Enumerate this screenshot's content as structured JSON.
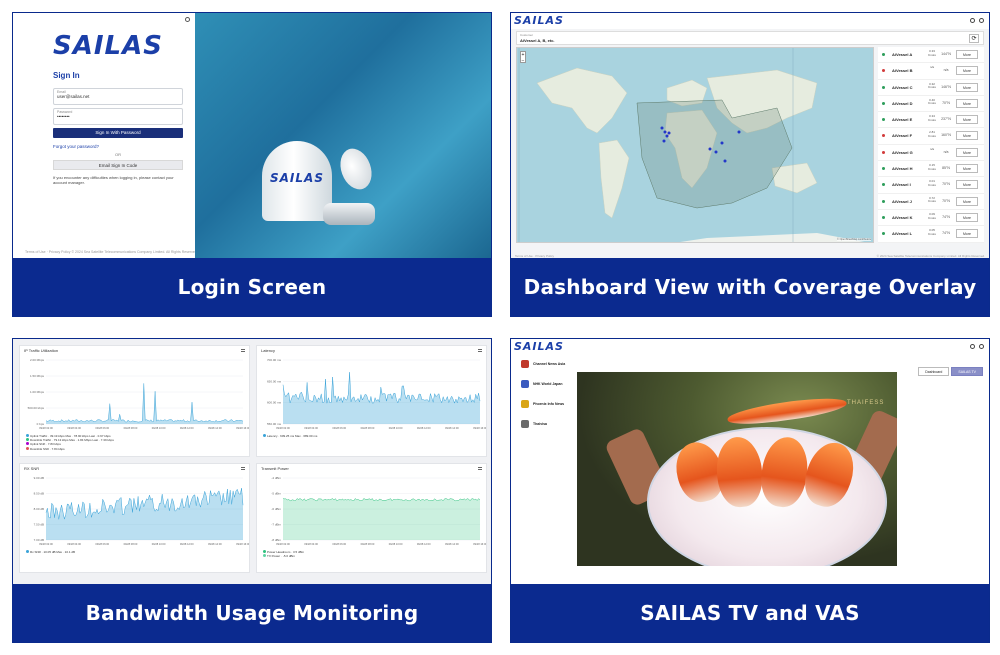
{
  "captions": {
    "login": "Login Screen",
    "dashboard": "Dashboard View with Coverage Overlay",
    "bandwidth": "Bandwidth Usage Monitoring",
    "tv": "SAILAS TV and VAS"
  },
  "brand": {
    "name": "SAILAS",
    "primary": "#0b2a8f",
    "accent": "#1b3fa8"
  },
  "login": {
    "title": "Sign In",
    "email_label": "Email",
    "email_value": "user@sailas.net",
    "password_label": "Password",
    "password_value": "••••••••",
    "sign_in_button": "Sign In With Password",
    "forgot": "Forgot your password?",
    "or": "OR",
    "email_code_button": "Email Sign In Code",
    "help_text": "If you encounter any difficulties when logging in, please contact your account manager.",
    "footer": "Terms of Use · Privacy Policy   © 2024 Sea Satellite Telecommunications Company Limited. All Rights Reserved."
  },
  "dashboard": {
    "filter_label": "Customer",
    "filter_value": "AiVessel A, B, etc.",
    "refresh_icon": "refresh-icon",
    "map_attribution": "© OpenStreetMap contributors",
    "vessels": [
      {
        "name": "AiVessel A",
        "speed": "0.33 Knots",
        "heading": "144°N",
        "status": "#2e9e5b"
      },
      {
        "name": "AiVessel B",
        "speed": "n/a",
        "heading": "n/a",
        "status": "#d23b3b"
      },
      {
        "name": "AiVessel C",
        "speed": "0.32 Knots",
        "heading": "146°N",
        "status": "#2e9e5b"
      },
      {
        "name": "AiVessel D",
        "speed": "0.40 Knots",
        "heading": "70°N",
        "status": "#2e9e5b"
      },
      {
        "name": "AiVessel E",
        "speed": "0.34 Knots",
        "heading": "237°N",
        "status": "#2e9e5b"
      },
      {
        "name": "AiVessel F",
        "speed": "2.81 Knots",
        "heading": "160°N",
        "status": "#d23b3b"
      },
      {
        "name": "AiVessel G",
        "speed": "n/a",
        "heading": "n/a",
        "status": "#d23b3b"
      },
      {
        "name": "AiVessel H",
        "speed": "0.15 Knots",
        "heading": "85°N",
        "status": "#2e9e5b"
      },
      {
        "name": "AiVessel I",
        "speed": "0.01 Knots",
        "heading": "70°N",
        "status": "#2e9e5b"
      },
      {
        "name": "AiVessel J",
        "speed": "0.72 Knots",
        "heading": "70°N",
        "status": "#2e9e5b"
      },
      {
        "name": "AiVessel K",
        "speed": "0.09 Knots",
        "heading": "74°N",
        "status": "#2e9e5b"
      },
      {
        "name": "AiVessel L",
        "speed": "0.05 Knots",
        "heading": "74°N",
        "status": "#2e9e5b"
      }
    ],
    "vessel_button": "More",
    "footer_left": "Terms of Use · Privacy Policy",
    "footer_right": "© 2024 Sea Satellite Telecommunications Company Limited. All Rights Reserved."
  },
  "bandwidth": {
    "charts": [
      {
        "title": "IP Traffic Utilization",
        "yticks": [
          "2.00 Mbps",
          "1.50 Mbps",
          "1.00 Mbps",
          "500.00 kbps",
          "0 bps"
        ],
        "legend": [
          "Uplink Traffic · 39.19 kbps Max · 78.90 kbps Last · 0.97 kbps",
          "Downlink Traffic · 79.13 kbps Max · 1.84 Mbps Last · 7.39 kbps",
          "Uplink Shift · 7.83 kbps",
          "Downlink Shift · 7.84 kbps"
        ]
      },
      {
        "title": "Latency",
        "yticks": [
          "700.00 ms",
          "650.00 ms",
          "600.00 ms",
          "550.00 ms"
        ],
        "legend": [
          "Latency · 609.25 ms Max · 689.00 ms"
        ]
      },
      {
        "title": "RX SNR",
        "yticks": [
          "9.00 dB",
          "8.50 dB",
          "8.00 dB",
          "7.50 dB",
          "7.00 dB"
        ],
        "legend": [
          "Rx SNR · 10.05 dB Max · 10.1 dB"
        ]
      },
      {
        "title": "Transmit Power",
        "yticks": [
          "-4 dBm",
          "-5 dBm",
          "-6 dBm",
          "-7 dBm",
          "-8 dBm"
        ],
        "legend": [
          "Power Headroom · 3.5 dBm",
          "TX Power · -5.0 dBm"
        ]
      }
    ],
    "xticks": [
      "09/28 02:00",
      "09/28 04:00",
      "09/28 06:00",
      "09/28 08:00",
      "09/28 10:00",
      "09/28 12:00",
      "09/28 14:00",
      "09/28 16:00"
    ]
  },
  "tv": {
    "channels": [
      {
        "name": "Channel News Asia",
        "color": "#c0392b"
      },
      {
        "name": "NHK World Japan",
        "color": "#3b5bbf"
      },
      {
        "name": "Phoenix Info News",
        "color": "#d9a516"
      },
      {
        "name": "Thaivisa",
        "color": "#6a6a6a"
      }
    ],
    "tabs": [
      "Dashboard",
      "SAILAS TV"
    ],
    "watermark": "THAIFESS"
  }
}
